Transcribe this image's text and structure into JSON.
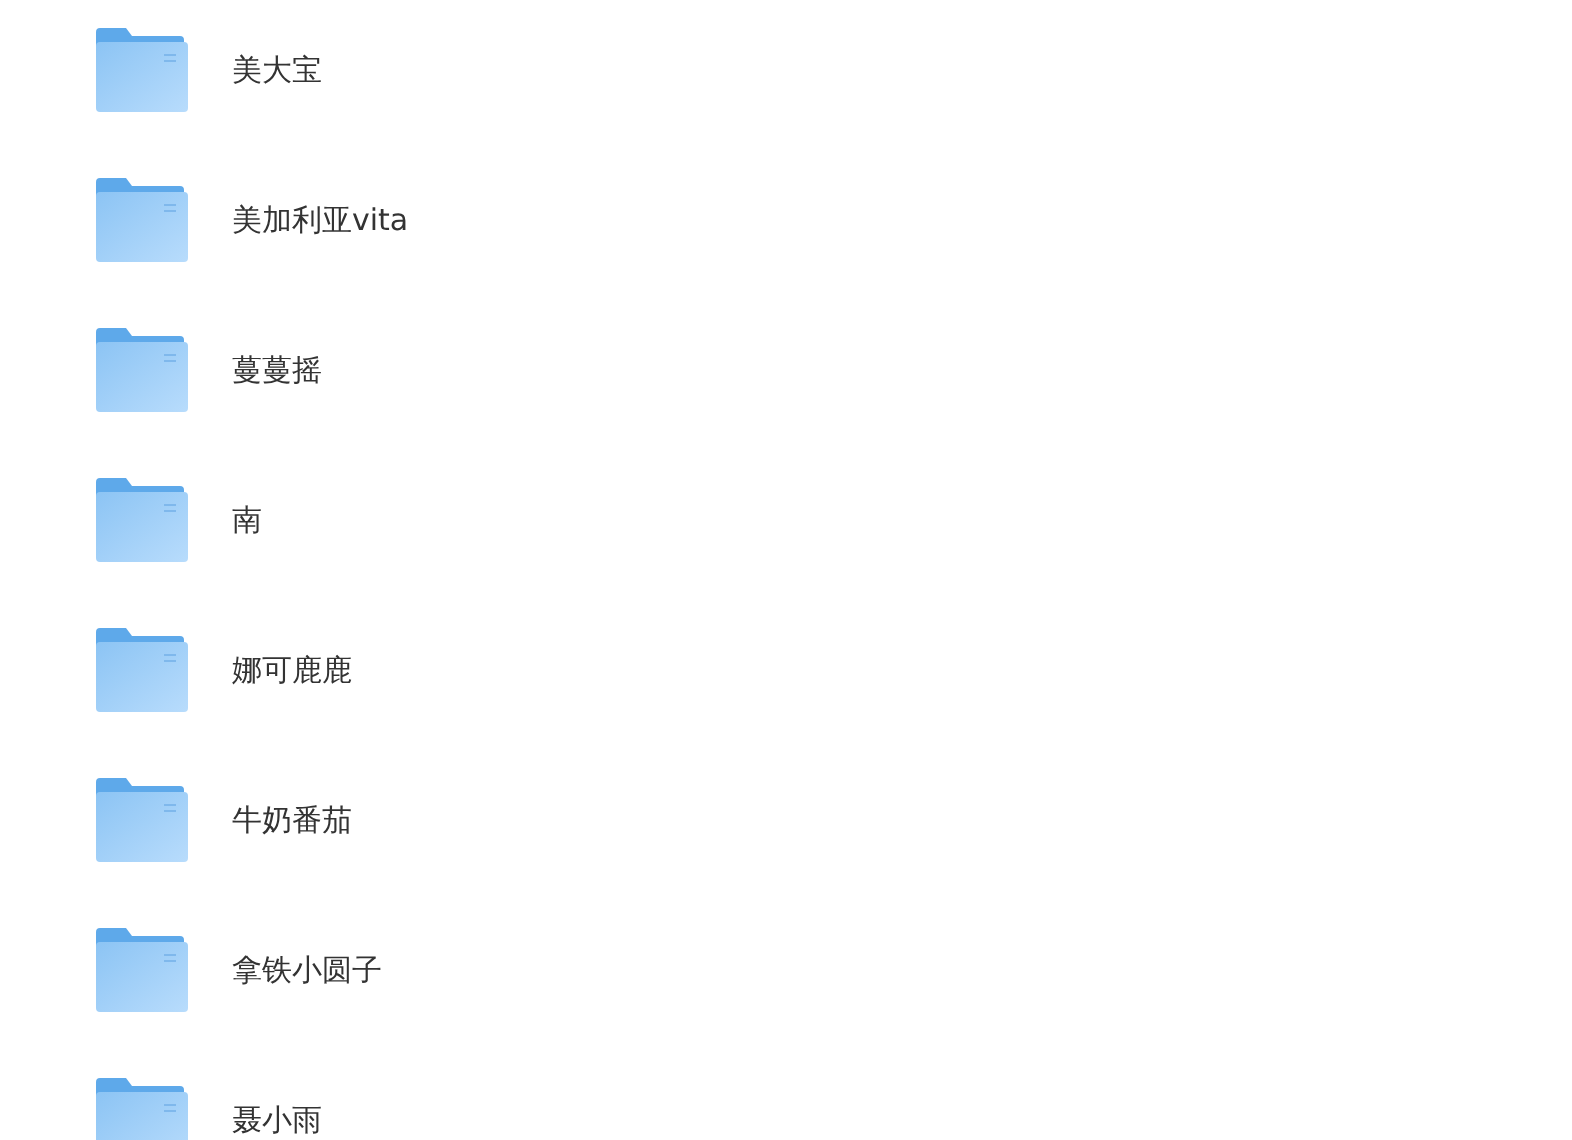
{
  "folders": [
    {
      "name": "美大宝"
    },
    {
      "name": "美加利亚vita"
    },
    {
      "name": "蔓蔓摇"
    },
    {
      "name": "南"
    },
    {
      "name": "娜可鹿鹿"
    },
    {
      "name": "牛奶番茄"
    },
    {
      "name": "拿铁小圆子"
    },
    {
      "name": "聂小雨"
    }
  ]
}
